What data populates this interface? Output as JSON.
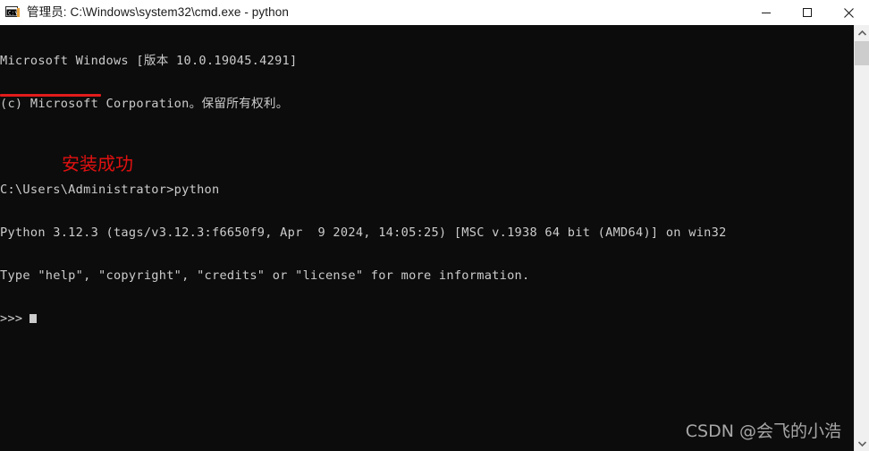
{
  "window": {
    "title": "管理员: C:\\Windows\\system32\\cmd.exe - python",
    "icon": "cmd-exe-icon",
    "controls": {
      "minimize_label": "最小化",
      "maximize_label": "最大化",
      "close_label": "关闭"
    }
  },
  "console": {
    "background_color": "#0c0c0c",
    "foreground_color": "#cccccc",
    "lines": [
      "Microsoft Windows [版本 10.0.19045.4291]",
      "(c) Microsoft Corporation。保留所有权利。",
      "",
      "C:\\Users\\Administrator>python",
      "Python 3.12.3 (tags/v3.12.3:f6650f9, Apr  9 2024, 14:05:25) [MSC v.1938 64 bit (AMD64)] on win32",
      "Type \"help\", \"copyright\", \"credits\" or \"license\" for more information.",
      ">>>"
    ],
    "prompt": ">>>",
    "cursor_visible": true
  },
  "annotations": {
    "underline": {
      "target_text": "Python 3.12.3",
      "color": "#e21b1b"
    },
    "note": {
      "text": "安装成功",
      "color": "#e01010"
    }
  },
  "watermark": {
    "text": "CSDN @会飞的小浩",
    "color": "#b5b5b5"
  },
  "scrollbar": {
    "up_arrow": "chevron-up-icon",
    "down_arrow": "chevron-down-icon",
    "thumb_position_percent": 2
  }
}
